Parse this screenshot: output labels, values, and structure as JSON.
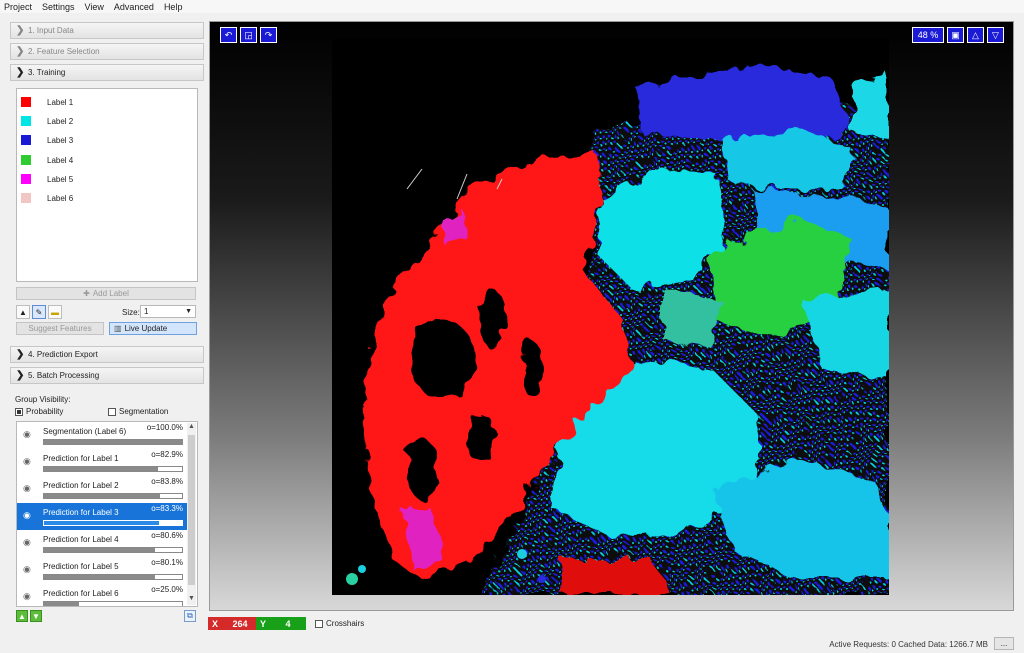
{
  "menu": {
    "items": [
      "Project",
      "Settings",
      "View",
      "Advanced",
      "Help"
    ]
  },
  "drawers": {
    "input_data": "1. Input Data",
    "feature_selection": "2. Feature Selection",
    "training": "3. Training",
    "prediction_export": "4. Prediction Export",
    "batch_processing": "5. Batch Processing"
  },
  "labels": [
    {
      "name": "Label 1",
      "color": "#ff0000"
    },
    {
      "name": "Label 2",
      "color": "#00e5e5"
    },
    {
      "name": "Label 3",
      "color": "#1a1ad6"
    },
    {
      "name": "Label 4",
      "color": "#2ecc2e"
    },
    {
      "name": "Label 5",
      "color": "#ff00ff"
    },
    {
      "name": "Label 6",
      "color": "#f3c6c6"
    }
  ],
  "training": {
    "add_label": "Add Label",
    "size_label": "Size:",
    "size_value": "1",
    "suggest_features": "Suggest Features",
    "live_update": "Live Update"
  },
  "group_visibility": {
    "title": "Group Visibility:",
    "probability": "Probability",
    "segmentation": "Segmentation",
    "probability_checked": true,
    "segmentation_checked": false
  },
  "layers": [
    {
      "name": "Segmentation (Label 6)",
      "opacity": "o=100.0%",
      "value": 1.0,
      "selected": false
    },
    {
      "name": "Prediction for Label 1",
      "opacity": "o=82.9%",
      "value": 0.829,
      "selected": false
    },
    {
      "name": "Prediction for Label 2",
      "opacity": "o=83.8%",
      "value": 0.838,
      "selected": false
    },
    {
      "name": "Prediction for Label 3",
      "opacity": "o=83.3%",
      "value": 0.833,
      "selected": true
    },
    {
      "name": "Prediction for Label 4",
      "opacity": "o=80.6%",
      "value": 0.806,
      "selected": false
    },
    {
      "name": "Prediction for Label 5",
      "opacity": "o=80.1%",
      "value": 0.801,
      "selected": false
    },
    {
      "name": "Prediction for Label 6",
      "opacity": "o=25.0%",
      "value": 0.25,
      "selected": false
    }
  ],
  "viewer": {
    "zoom": "48 %"
  },
  "coords": {
    "x_label": "X",
    "x_value": "264",
    "y_label": "Y",
    "y_value": "4",
    "crosshairs": "Crosshairs"
  },
  "status": {
    "text": "Active Requests: 0  Cached Data: 1266.7 MB",
    "more": "..."
  }
}
